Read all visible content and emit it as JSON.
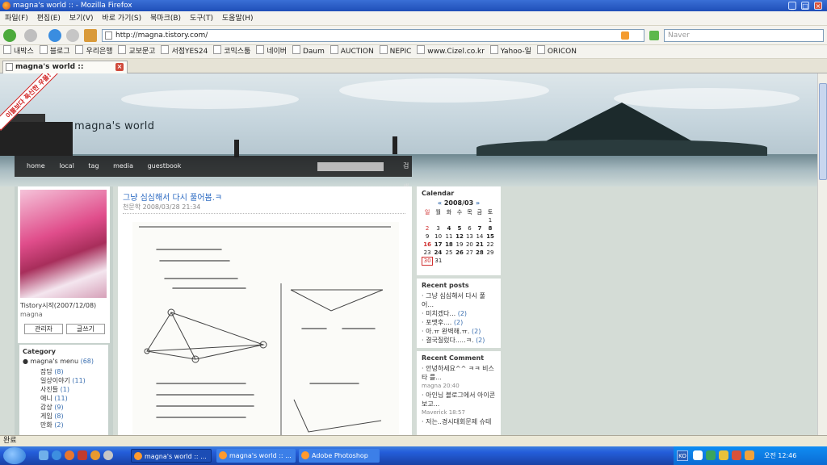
{
  "window": {
    "title": "magna's world :: - Mozilla Firefox",
    "controls": [
      "_",
      "□",
      "×"
    ]
  },
  "menu": [
    "파일(F)",
    "편집(E)",
    "보기(V)",
    "바로 가기(S)",
    "북마크(B)",
    "도구(T)",
    "도움말(H)"
  ],
  "address": {
    "url": "http://magna.tistory.com/"
  },
  "search": {
    "placeholder": "Naver"
  },
  "bookmarks": [
    "내박스",
    "블로그",
    "우리은행",
    "교보문고",
    "서점YES24",
    "코믹스툼",
    "네이버",
    "Daum",
    "AUCTION",
    "NEPIC",
    "www.Cizel.co.kr",
    "Yahoo-일",
    "ORICON"
  ],
  "tab": {
    "label": "magna's world ::"
  },
  "site": {
    "title": "magna's world",
    "ribbon": "이불보다 푹신한 우물!",
    "nav": [
      "home",
      "local",
      "tag",
      "media",
      "guestbook"
    ],
    "search_button": "검색"
  },
  "profile": {
    "notice": "Tistory시작(2007/12/08)",
    "name": "magna",
    "admin_button": "관리자",
    "write_button": "글쓰기"
  },
  "category": {
    "title": "Category",
    "root": "magna's menu",
    "root_count": "(68)",
    "items": [
      {
        "label": "잡담",
        "count": "(8)"
      },
      {
        "label": "일상이야기",
        "count": "(11)"
      },
      {
        "label": "사진들",
        "count": "(1)"
      },
      {
        "label": "애니",
        "count": "(11)"
      },
      {
        "label": "감상",
        "count": "(9)"
      },
      {
        "label": "게임",
        "count": "(8)"
      },
      {
        "label": "만화",
        "count": "(2)"
      }
    ]
  },
  "post": {
    "title": "그냥 심심해서 다시 풀어봄.ㅋ",
    "category": "천문학",
    "date": "2008/03/28 21:34"
  },
  "calendar": {
    "title": "Calendar",
    "month": "2008/03",
    "prev": "«",
    "next": "»",
    "weekdays": [
      "일",
      "월",
      "화",
      "수",
      "목",
      "금",
      "토"
    ],
    "weeks": [
      [
        "",
        "",
        "",
        "",
        "",
        "",
        "1"
      ],
      [
        "2",
        "3",
        "4",
        "5",
        "6",
        "7",
        "8"
      ],
      [
        "9",
        "10",
        "11",
        "12",
        "13",
        "14",
        "15"
      ],
      [
        "16",
        "17",
        "18",
        "19",
        "20",
        "21",
        "22"
      ],
      [
        "23",
        "24",
        "25",
        "26",
        "27",
        "28",
        "29"
      ],
      [
        "30",
        "31",
        "",
        "",
        "",
        "",
        ""
      ]
    ]
  },
  "recent_posts": {
    "title": "Recent posts",
    "items": [
      {
        "label": "그냥 심심해서 다시 풀어...",
        "count": ""
      },
      {
        "label": "미치겠다...",
        "count": "(2)"
      },
      {
        "label": "포맷후....",
        "count": "(2)"
      },
      {
        "label": "아.ㅠ 완벽해.ㅠ.",
        "count": "(2)"
      },
      {
        "label": "결국질렀다.....ㅋ.",
        "count": "(2)"
      }
    ]
  },
  "recent_comments": {
    "title": "Recent Comment",
    "items": [
      {
        "text": "안녕하세요^^ ㅋㅋ 비스타 를...",
        "meta": "magna 20:40"
      },
      {
        "text": "아인님 블로그에서 아이콘보고...",
        "meta": "Maverick 18:57"
      },
      {
        "text": "저는..경시대회문제 슈테",
        "meta": ""
      }
    ]
  },
  "status": {
    "text": "완료"
  },
  "taskbar": {
    "tasks": [
      "magna's world :: ...",
      "magna's world :: ...",
      "Adobe Photoshop"
    ],
    "tray_lang": "KO",
    "clock": "오전 12:46"
  },
  "colors": {
    "accent": "#2b6ac2",
    "sunday": "#d03030",
    "taskbar": "#245edb"
  }
}
